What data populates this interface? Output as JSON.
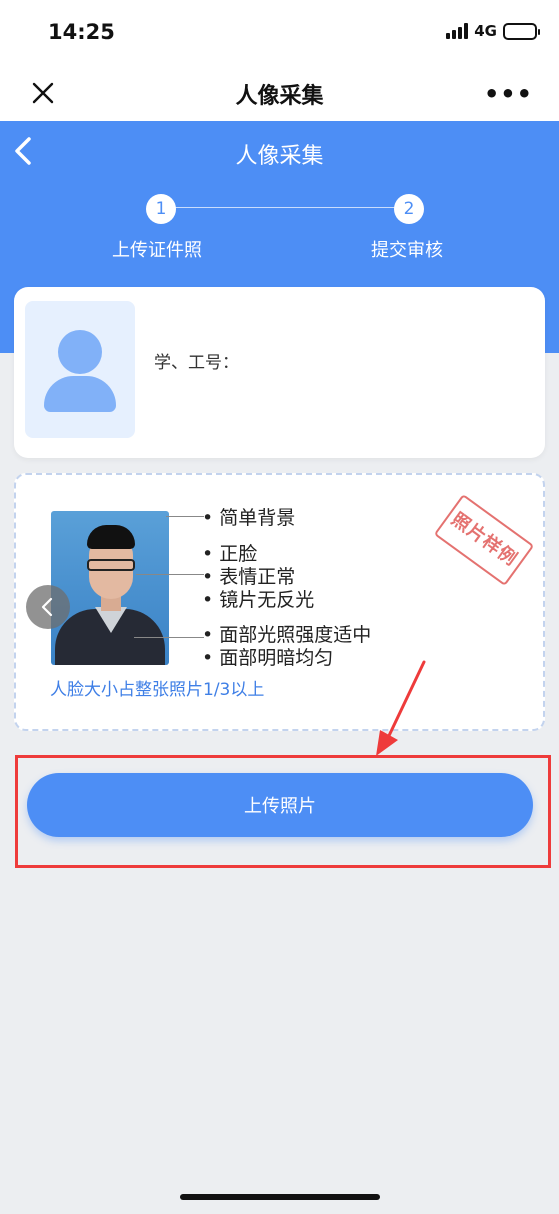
{
  "status_bar": {
    "time": "14:25",
    "network": "4G"
  },
  "nav": {
    "title": "人像采集",
    "more": "•••"
  },
  "header": {
    "title": "人像采集"
  },
  "steps": [
    {
      "number": "1",
      "label": "上传证件照"
    },
    {
      "number": "2",
      "label": "提交审核"
    }
  ],
  "user_card": {
    "id_label": "学、工号："
  },
  "sample": {
    "tips": [
      "简单背景",
      "正脸",
      "表情正常",
      "镜片无反光",
      "面部光照强度适中",
      "面部明暗均匀"
    ],
    "caption": "人脸大小占整张照片1/3以上",
    "stamp": "照片样例"
  },
  "upload_button": "上传照片",
  "colors": {
    "primary": "#4d8ef5",
    "highlight": "#ee3b3b"
  }
}
